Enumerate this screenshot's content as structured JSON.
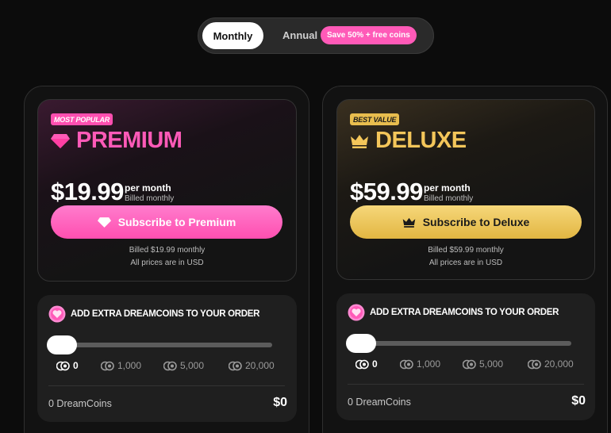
{
  "billing_toggle": {
    "monthly_label": "Monthly",
    "annual_label": "Annual",
    "annual_badge": "Save 50% + free coins",
    "selected": "Monthly"
  },
  "colors": {
    "premium_accent": "#ff5ab8",
    "deluxe_accent": "#f4c65a",
    "background": "#0c0c0c"
  },
  "plans": [
    {
      "tag": "MOST POPULAR",
      "icon": "diamond-icon",
      "name": "PREMIUM",
      "price": "$19.99",
      "period": "per month",
      "billed_cycle": "Billed monthly",
      "subscribe_label": "Subscribe to Premium",
      "billed_note": "Billed $19.99 monthly",
      "currency_note": "All prices are in USD",
      "coins": {
        "heading": "ADD EXTRA DREAMCOINS TO YOUR ORDER",
        "slider_value": 0,
        "options": [
          "0",
          "1,000",
          "5,000",
          "20,000"
        ],
        "summary": "0 DreamCoins",
        "total": "$0"
      }
    },
    {
      "tag": "BEST VALUE",
      "icon": "crown-icon",
      "name": "DELUXE",
      "price": "$59.99",
      "period": "per month",
      "billed_cycle": "Billed monthly",
      "subscribe_label": "Subscribe to Deluxe",
      "billed_note": "Billed $59.99 monthly",
      "currency_note": "All prices are in USD",
      "coins": {
        "heading": "ADD EXTRA DREAMCOINS TO YOUR ORDER",
        "slider_value": 0,
        "options": [
          "0",
          "1,000",
          "5,000",
          "20,000"
        ],
        "summary": "0 DreamCoins",
        "total": "$0"
      }
    }
  ]
}
